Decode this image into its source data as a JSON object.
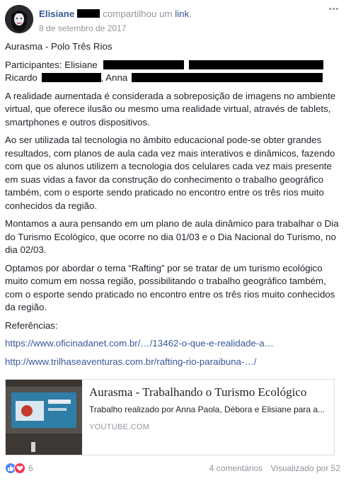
{
  "post": {
    "author": "Elisiane",
    "action_text": "compartilhou um",
    "action_link": "link",
    "action_end": ".",
    "date": "8 de setembro de 2017",
    "title": "Aurasma - Polo Três Rios",
    "participants_label": "Participantes: Elisiane",
    "participant_ricardo": "Ricardo",
    "participant_anna": ", Anna",
    "paragraphs": [
      "A realidade aumentada é considerada a sobreposição de imagens no ambiente virtual, que oferece ilusão ou mesmo uma realidade virtual, através de tablets, smartphones e outros dispositivos.",
      "Ao ser utilizada tal tecnologia no âmbito educacional pode-se obter grandes resultados, com planos de aula cada vez mais interativos e dinâmicos, fazendo com que os alunos utilizem a tecnologia dos celulares cada vez mais presente em suas vidas a favor da construção do conhecimento o trabalho geográfico também, com o esporte sendo praticado no encontro entre os três rios muito conhecidos da região.",
      "Montamos a aura pensando em um plano de aula dinâmico para trabalhar o Dia do Turismo Ecológico, que ocorre no dia 01/03 e o Dia Nacional do Turismo, no dia 02/03.",
      "Optamos por abordar o tema “Rafting” por se tratar de um turismo ecológico muito comum em nossa região, possibilitando o trabalho geográfico também, com o esporte sendo praticado no encontro entre os três rios muito conhecidos da região."
    ],
    "references_label": "Referências:",
    "links": [
      "https://www.oficinadanet.com.br/…/13462-o-que-e-realidade-a…",
      "http://www.trilhaseaventuras.com.br/rafting-rio-paraibuna-…/"
    ]
  },
  "link_card": {
    "title": "Aurasma - Trabalhando o Turismo Ecológico",
    "description": "Trabalho realizado por Anna Paola, Débora e Elisiane para a...",
    "domain": "YOUTUBE.COM"
  },
  "footer": {
    "reaction_count": "6",
    "comments": "4 comentários",
    "views": "Visualizado por 52"
  },
  "colors": {
    "link_blue": "#365899",
    "meta_gray": "#90949c",
    "text": "#1d2129",
    "like_blue": "#4f85f5",
    "love_red": "#f0384f"
  },
  "icons": [
    "more-options-icon",
    "like-reaction-icon",
    "love-reaction-icon"
  ]
}
